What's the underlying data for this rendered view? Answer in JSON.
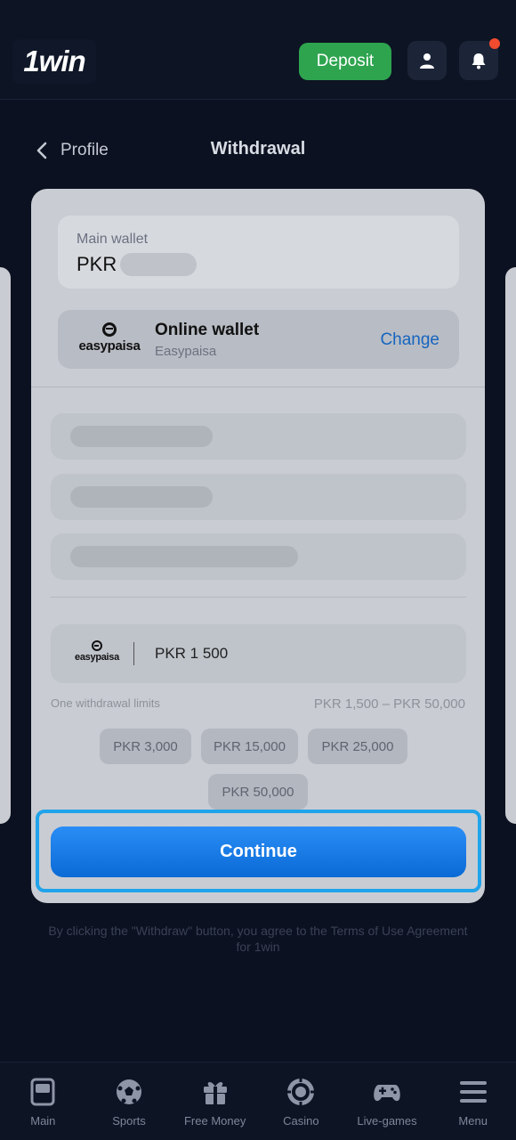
{
  "header": {
    "logo": "1win",
    "deposit_label": "Deposit"
  },
  "nav": {
    "back_label": "Profile",
    "title": "Withdrawal"
  },
  "wallet": {
    "label": "Main wallet",
    "currency": "PKR"
  },
  "method": {
    "logo_text": "easypaisa",
    "title": "Online wallet",
    "subtitle": "Easypaisa",
    "change_label": "Change"
  },
  "amount": {
    "logo_text": "easypaisa",
    "value": "PKR 1 500",
    "limits_label": "One withdrawal limits",
    "limits_range": "PKR 1,500  –  PKR 50,000",
    "presets": [
      "PKR 3,000",
      "PKR 15,000",
      "PKR 25,000",
      "PKR 50,000"
    ]
  },
  "continue_label": "Continue",
  "terms_text": "By clicking the \"Withdraw\" button, you agree to the Terms of Use Agreement for 1win",
  "bottom_nav": [
    {
      "label": "Main",
      "icon": "main-icon"
    },
    {
      "label": "Sports",
      "icon": "soccer-ball-icon"
    },
    {
      "label": "Free Money",
      "icon": "gift-icon"
    },
    {
      "label": "Casino",
      "icon": "casino-chip-icon"
    },
    {
      "label": "Live-games",
      "icon": "gamepad-icon"
    },
    {
      "label": "Menu",
      "icon": "menu-icon"
    }
  ],
  "colors": {
    "background": "#0b1120",
    "deposit": "#2ea44f",
    "accent_blue": "#0a6ad6",
    "highlight_border": "#1fa3ea",
    "notification": "#f24b2e"
  }
}
